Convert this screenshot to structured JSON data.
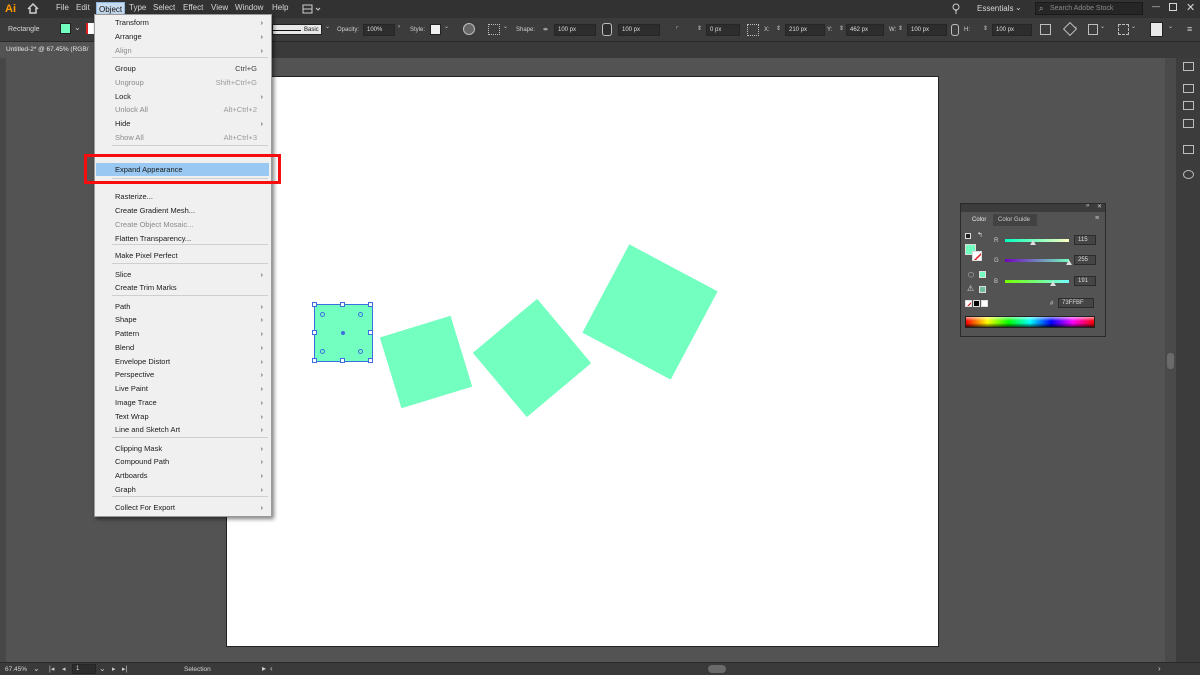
{
  "app": {
    "logo": "Ai",
    "home_icon": "home-icon"
  },
  "menubar": {
    "items": [
      "File",
      "Edit",
      "Object",
      "Type",
      "Select",
      "Effect",
      "View",
      "Window",
      "Help"
    ],
    "workspace": "Essentials",
    "search_placeholder": "Search Adobe Stock"
  },
  "controlbar": {
    "tool_name": "Rectangle",
    "stroke_style": "Basic",
    "opacity_label": "Opacity:",
    "opacity_value": "100%",
    "style_label": "Style:",
    "shape_label": "Shape:",
    "shape_w": "100 px",
    "shape_h": "100 px",
    "corner": "0 px",
    "x_label": "X:",
    "x_value": "210 px",
    "y_label": "Y:",
    "y_value": "462 px",
    "w_label": "W:",
    "w_value": "100 px",
    "h_label": "H:",
    "h_value": "100 px"
  },
  "document_tab": "Untitled-2* @ 67.45% (RGB/",
  "object_menu": {
    "items": [
      {
        "label": "Transform",
        "shortcut": "",
        "submenu": true,
        "disabled": false
      },
      {
        "label": "Arrange",
        "shortcut": "",
        "submenu": true,
        "disabled": false
      },
      {
        "label": "Align",
        "shortcut": "",
        "submenu": true,
        "disabled": true
      },
      {
        "label": "Group",
        "shortcut": "Ctrl+G",
        "submenu": false,
        "disabled": false
      },
      {
        "label": "Ungroup",
        "shortcut": "Shift+Ctrl+G",
        "submenu": false,
        "disabled": true
      },
      {
        "label": "Lock",
        "shortcut": "",
        "submenu": true,
        "disabled": false
      },
      {
        "label": "Unlock All",
        "shortcut": "Alt+Ctrl+2",
        "submenu": false,
        "disabled": true
      },
      {
        "label": "Hide",
        "shortcut": "",
        "submenu": true,
        "disabled": false
      },
      {
        "label": "Show All",
        "shortcut": "Alt+Ctrl+3",
        "submenu": false,
        "disabled": true
      },
      {
        "label": "Expand Appearance",
        "shortcut": "",
        "submenu": false,
        "disabled": false
      },
      {
        "label": "Rasterize...",
        "shortcut": "",
        "submenu": false,
        "disabled": false
      },
      {
        "label": "Create Gradient Mesh...",
        "shortcut": "",
        "submenu": false,
        "disabled": false
      },
      {
        "label": "Create Object Mosaic...",
        "shortcut": "",
        "submenu": false,
        "disabled": true
      },
      {
        "label": "Flatten Transparency...",
        "shortcut": "",
        "submenu": false,
        "disabled": false
      },
      {
        "label": "Make Pixel Perfect",
        "shortcut": "",
        "submenu": false,
        "disabled": false
      },
      {
        "label": "Slice",
        "shortcut": "",
        "submenu": true,
        "disabled": false
      },
      {
        "label": "Create Trim Marks",
        "shortcut": "",
        "submenu": false,
        "disabled": false
      },
      {
        "label": "Path",
        "shortcut": "",
        "submenu": true,
        "disabled": false
      },
      {
        "label": "Shape",
        "shortcut": "",
        "submenu": true,
        "disabled": false
      },
      {
        "label": "Pattern",
        "shortcut": "",
        "submenu": true,
        "disabled": false
      },
      {
        "label": "Blend",
        "shortcut": "",
        "submenu": true,
        "disabled": false
      },
      {
        "label": "Envelope Distort",
        "shortcut": "",
        "submenu": true,
        "disabled": false
      },
      {
        "label": "Perspective",
        "shortcut": "",
        "submenu": true,
        "disabled": false
      },
      {
        "label": "Live Paint",
        "shortcut": "",
        "submenu": true,
        "disabled": false
      },
      {
        "label": "Image Trace",
        "shortcut": "",
        "submenu": true,
        "disabled": false
      },
      {
        "label": "Text Wrap",
        "shortcut": "",
        "submenu": true,
        "disabled": false
      },
      {
        "label": "Line and Sketch Art",
        "shortcut": "",
        "submenu": true,
        "disabled": false
      },
      {
        "label": "Clipping Mask",
        "shortcut": "",
        "submenu": true,
        "disabled": false
      },
      {
        "label": "Compound Path",
        "shortcut": "",
        "submenu": true,
        "disabled": false
      },
      {
        "label": "Artboards",
        "shortcut": "",
        "submenu": true,
        "disabled": false
      },
      {
        "label": "Graph",
        "shortcut": "",
        "submenu": true,
        "disabled": false
      },
      {
        "label": "Collect For Export",
        "shortcut": "",
        "submenu": true,
        "disabled": false
      }
    ],
    "highlighted": "Expand Appearance"
  },
  "color_panel": {
    "tabs": [
      "Color",
      "Color Guide"
    ],
    "r_label": "R",
    "r_value": "115",
    "g_label": "G",
    "g_value": "255",
    "b_label": "B",
    "b_value": "191",
    "hex_label": "#",
    "hex_value": "73FFBF"
  },
  "statusbar": {
    "zoom": "67.45%",
    "artboard": "1",
    "tool": "Selection"
  },
  "colors": {
    "fill": "#73ffbf",
    "highlight_box": "#f70d0d",
    "menu_highlight": "#99c9f2"
  }
}
